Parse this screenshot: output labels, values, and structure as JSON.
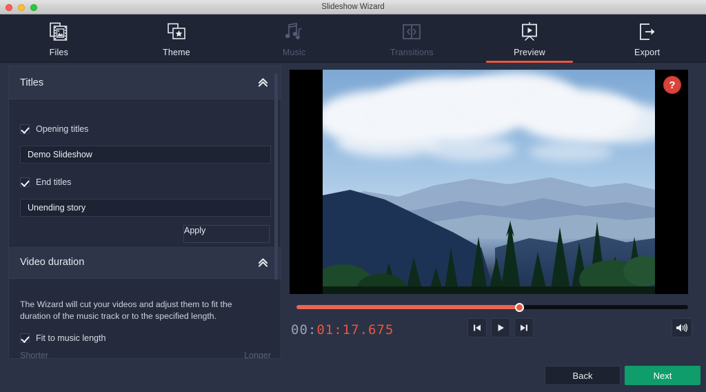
{
  "window": {
    "title": "Slideshow Wizard"
  },
  "toolbar": {
    "tabs": [
      {
        "label": "Files",
        "icon": "files-icon",
        "state": "enabled"
      },
      {
        "label": "Theme",
        "icon": "theme-icon",
        "state": "enabled"
      },
      {
        "label": "Music",
        "icon": "music-icon",
        "state": "disabled"
      },
      {
        "label": "Transitions",
        "icon": "transitions-icon",
        "state": "disabled"
      },
      {
        "label": "Preview",
        "icon": "preview-icon",
        "state": "active"
      },
      {
        "label": "Export",
        "icon": "export-icon",
        "state": "enabled"
      }
    ]
  },
  "sidebar": {
    "titles_section": {
      "header": "Titles",
      "collapse_icon": "double-chevron-up-icon",
      "opening_titles_label": "Opening titles",
      "opening_titles_checked": true,
      "opening_titles_value": "Demo Slideshow",
      "opening_titles_placeholder": "Opening titles",
      "end_titles_label": "End titles",
      "end_titles_checked": true,
      "end_titles_value": "Unending story",
      "end_titles_placeholder": "End titles",
      "apply_label": "Apply"
    },
    "duration_section": {
      "header": "Video duration",
      "collapse_icon": "double-chevron-up-icon",
      "description": "The Wizard will cut your videos and adjust them to fit the duration of the music track or to the specified length.",
      "fit_label": "Fit to music length",
      "fit_checked": true,
      "slider_min_label": "Shorter",
      "slider_max_label": "Longer"
    }
  },
  "preview": {
    "help_label": "?",
    "help_icon": "question-mark-icon",
    "seek_percent": 57,
    "timecode_dim": "00:",
    "timecode_hot": "01:17.675",
    "controls": [
      {
        "name": "previous-button",
        "icon": "skip-previous-icon"
      },
      {
        "name": "play-button",
        "icon": "play-icon"
      },
      {
        "name": "next-button",
        "icon": "skip-next-icon"
      }
    ],
    "volume_icon": "volume-high-icon"
  },
  "footer": {
    "back_label": "Back",
    "next_label": "Next"
  },
  "colors": {
    "accent_red": "#e8573f",
    "next_green": "#0f9d6b",
    "panel": "#252b3c",
    "app_bg": "#2b3245"
  }
}
